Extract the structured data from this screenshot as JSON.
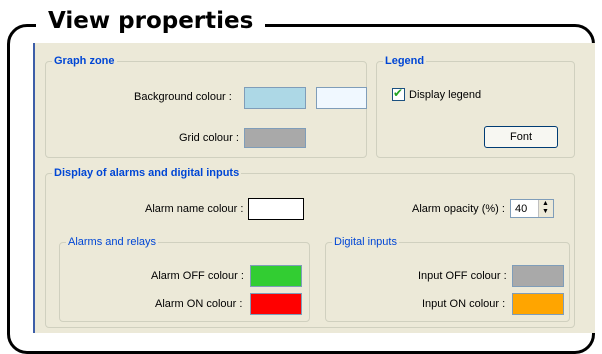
{
  "page": {
    "title": "View properties"
  },
  "graph_zone": {
    "title": "Graph zone",
    "background_colour_label": "Background colour :",
    "background_colours": [
      "#add8e6",
      "#f0f8ff"
    ],
    "grid_colour_label": "Grid colour :",
    "grid_colour": "#a9a9a9"
  },
  "legend": {
    "title": "Legend",
    "display_legend_label": "Display legend",
    "display_legend_checked": true,
    "font_button": "Font"
  },
  "alarms_display": {
    "title": "Display of alarms and digital inputs",
    "alarm_name_colour_label": "Alarm name colour :",
    "alarm_name_colour": "#ffffff",
    "alarm_opacity_label": "Alarm opacity (%) :",
    "alarm_opacity_value": "40",
    "alarms_and_relays": {
      "title": "Alarms and relays",
      "alarm_off_label": "Alarm OFF colour :",
      "alarm_off_colour": "#32cd32",
      "alarm_on_label": "Alarm ON colour :",
      "alarm_on_colour": "#ff0000"
    },
    "digital_inputs": {
      "title": "Digital inputs",
      "input_off_label": "Input OFF colour :",
      "input_off_colour": "#a9a9a9",
      "input_on_label": "Input ON colour :",
      "input_on_colour": "#ffa500"
    }
  }
}
